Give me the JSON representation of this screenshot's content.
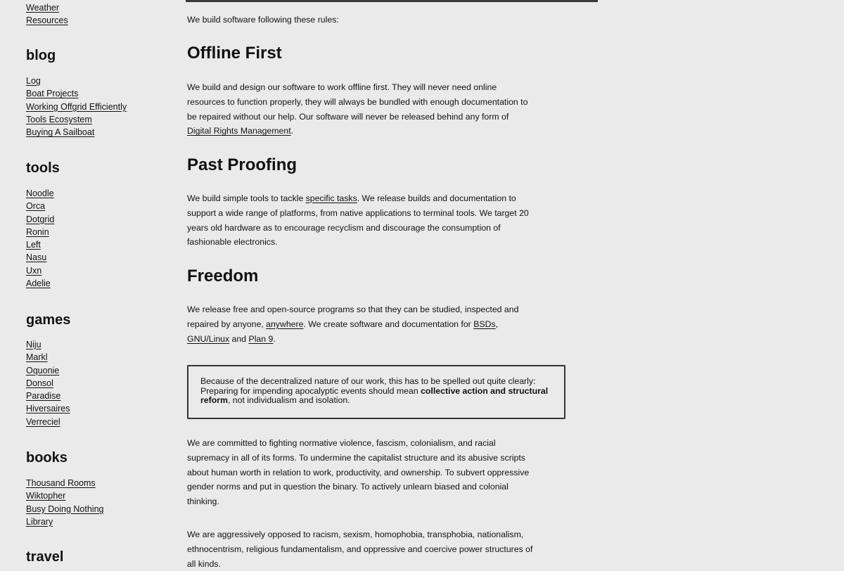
{
  "sidebar": {
    "top_links": [
      "Weather",
      "Resources"
    ],
    "sections": [
      {
        "title": "blog",
        "links": [
          "Log",
          "Boat Projects",
          "Working Offgrid Efficiently",
          "Tools Ecosystem",
          "Buying A Sailboat"
        ]
      },
      {
        "title": "tools",
        "links": [
          "Noodle",
          "Orca",
          "Dotgrid",
          "Ronin",
          "Left",
          "Nasu",
          "Uxn",
          "Adelie"
        ]
      },
      {
        "title": "games",
        "links": [
          "Niju",
          "Markl",
          "Oquonie",
          "Donsol",
          "Paradise",
          "Hiversaires",
          "Verreciel"
        ]
      },
      {
        "title": "books",
        "links": [
          "Thousand Rooms",
          "Wiktopher",
          "Busy Doing Nothing",
          "Library"
        ]
      },
      {
        "title": "travel",
        "links": []
      }
    ]
  },
  "main": {
    "intro": "We build software following these rules:",
    "offline_first": {
      "heading": "Offline First",
      "text_before": "We build and design our software to work offline first. They will never need online resources to function properly, they will always be bundled with enough documentation to be repaired without our help. Our software will never be released behind any form of ",
      "link": "Digital Rights Management",
      "text_after": "."
    },
    "past_proofing": {
      "heading": "Past Proofing",
      "text_before": "We build simple tools to tackle ",
      "link": "specific tasks",
      "text_after": ". We release builds and documentation to support a wide range of platforms, from native applications to terminal tools. We target 20 years old hardware as to encourage recyclism and discourage the consumption of fashionable electronics."
    },
    "freedom": {
      "heading": "Freedom",
      "text_1": "We release free and open-source programs so that they can be studied, inspected and repaired by anyone, ",
      "link_anywhere": "anywhere",
      "text_2": ". We create software and documentation for ",
      "link_bsd": "BSDs",
      "sep": ", ",
      "link_gnu": "GNU/Linux",
      "and": " and ",
      "link_plan9": "Plan 9",
      "end": "."
    },
    "callout": {
      "text_before": "Because of the decentralized nature of our work, this has to be spelled out quite clearly: Preparing for impending apocalyptic events should mean ",
      "bold": "collective action and structural reform",
      "text_after": ", not individualism and isolation."
    },
    "para_commitment": "We are committed to fighting normative violence, fascism, colonialism, and racial supremacy in all of its forms. To undermine the capitalist structure and its abusive scripts about human worth in relation to work, productivity, and ownership. To subvert oppressive gender norms and put in question the binary. To actively unlearn biased and colonial thinking.",
    "para_opposed": "We are aggressively opposed to racism, sexism, homophobia, transphobia, nationalism, ethnocentrism, religious fundamentalism, and oppressive and coercive power structures of all kinds."
  }
}
